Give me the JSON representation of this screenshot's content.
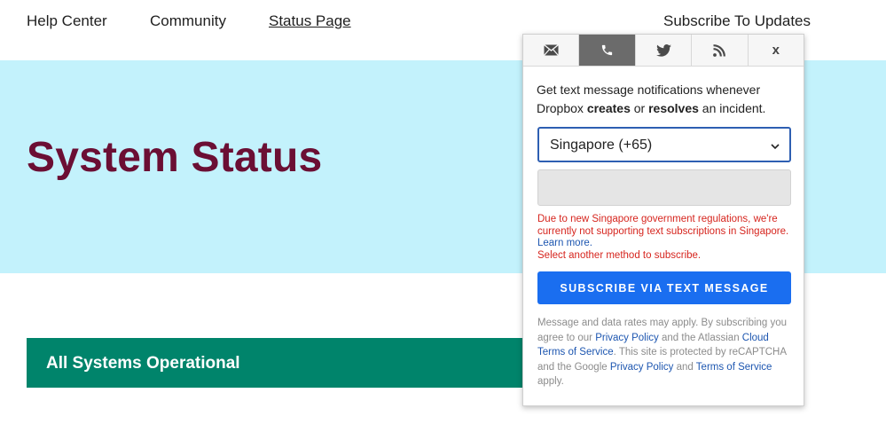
{
  "nav": {
    "help_center": "Help Center",
    "community": "Community",
    "status_page": "Status Page",
    "subscribe": "Subscribe To Updates"
  },
  "hero": {
    "title": "System Status"
  },
  "status": {
    "text": "All Systems Operational"
  },
  "popup": {
    "tabs": [
      {
        "icon": "email-icon",
        "active": false
      },
      {
        "icon": "phone-icon",
        "active": true
      },
      {
        "icon": "twitter-icon",
        "active": false
      },
      {
        "icon": "rss-icon",
        "active": false
      },
      {
        "icon": "close-icon",
        "label": "x",
        "active": false
      }
    ],
    "desc": {
      "part1": "Get text message notifications whenever Dropbox ",
      "creates": "creates",
      "part2": " or ",
      "resolves": "resolves",
      "part3": " an incident."
    },
    "country_select": {
      "value": "Singapore (+65)"
    },
    "phone_input": {
      "value": "",
      "placeholder": ""
    },
    "warning": {
      "text1": "Due to new Singapore government regulations, we're currently not supporting text subscriptions in Singapore. ",
      "learn_more": "Learn more.",
      "text2": "Select another method to subscribe."
    },
    "subscribe_button": "SUBSCRIBE VIA TEXT MESSAGE",
    "fine_print": {
      "t1": "Message and data rates may apply. By subscribing you agree to our ",
      "privacy_policy": "Privacy Policy",
      "t2": " and the Atlassian ",
      "cloud_terms": "Cloud Terms of Service",
      "t3": ". This site is protected by reCAPTCHA and the Google ",
      "google_privacy": "Privacy Policy",
      "t4": " and ",
      "google_terms": "Terms of Service",
      "t5": " apply."
    }
  },
  "colors": {
    "hero_bg": "#c3f2fc",
    "title": "#6b0f34",
    "status_bg": "#00846b",
    "button_blue": "#1a6ef0",
    "link_blue": "#1d56b0",
    "warning_red": "#d6251e"
  }
}
